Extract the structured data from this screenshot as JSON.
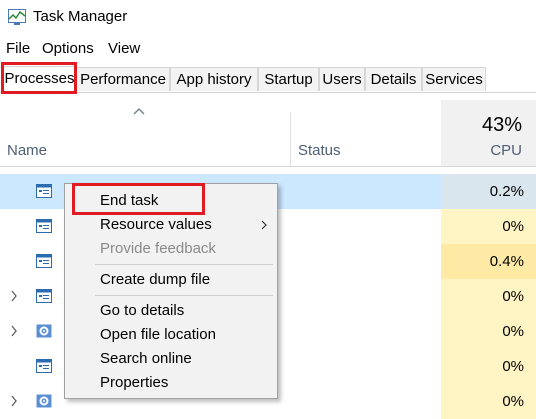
{
  "app": {
    "title": "Task Manager",
    "icon": "task-manager-icon"
  },
  "menu": {
    "items": [
      "File",
      "Options",
      "View"
    ]
  },
  "tabs": {
    "items": [
      "Processes",
      "Performance",
      "App history",
      "Startup",
      "Users",
      "Details",
      "Services"
    ],
    "selected": "Processes"
  },
  "table": {
    "columns": {
      "name": "Name",
      "status": "Status",
      "cpu_percent": "43%",
      "cpu": "CPU"
    },
    "rows": [
      {
        "cpu": "0.2%",
        "selected": true,
        "icon": "window-app-icon"
      },
      {
        "cpu": "0%",
        "icon": "window-app-icon"
      },
      {
        "cpu": "0.4%",
        "icon": "window-app-icon"
      },
      {
        "cpu": "0%",
        "icon": "window-app-icon",
        "expandable": true
      },
      {
        "cpu": "0%",
        "icon": "gear-service-icon",
        "expandable": true
      },
      {
        "cpu": "0%",
        "icon": "window-app-icon"
      },
      {
        "cpu": "0%",
        "icon": "gear-service-icon",
        "expandable": true
      }
    ]
  },
  "context_menu": {
    "items": [
      {
        "label": "End task",
        "disabled": false
      },
      {
        "label": "Resource values",
        "disabled": false,
        "submenu": true
      },
      {
        "label": "Provide feedback",
        "disabled": true
      },
      {
        "label": "Create dump file",
        "disabled": false
      },
      {
        "label": "Go to details",
        "disabled": false
      },
      {
        "label": "Open file location",
        "disabled": false
      },
      {
        "label": "Search online",
        "disabled": false
      },
      {
        "label": "Properties",
        "disabled": false
      }
    ]
  },
  "colors": {
    "highlight_box": "#e01b24",
    "selected_row": "#cce8ff",
    "cpu_light": "#fff4c4",
    "cpu_medium": "#ffeaa5",
    "header_text": "#4d5e74"
  }
}
